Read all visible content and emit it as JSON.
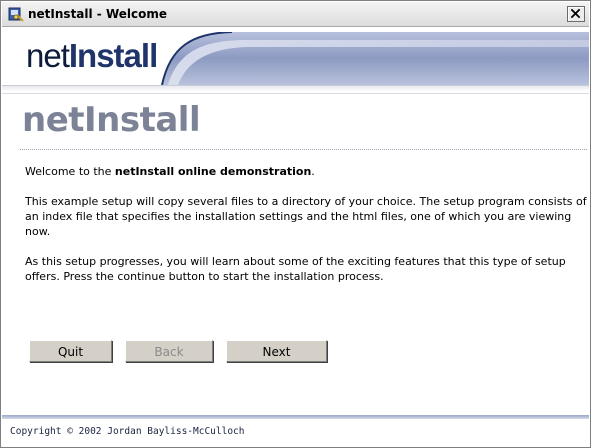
{
  "window": {
    "title": "netInstall - Welcome",
    "close_label": "×"
  },
  "banner": {
    "logo_prefix": "net",
    "logo_suffix": "Install"
  },
  "page": {
    "heading": "netInstall"
  },
  "content": {
    "welcome_prefix": "Welcome to the ",
    "welcome_bold": "netInstall online demonstration",
    "welcome_suffix": ".",
    "paragraph_2": "This example setup will copy several files to a directory of your choice. The setup program consists of an index file that specifies the installation settings and the html files, one of which you are viewing now.",
    "paragraph_3": "As this setup progresses, you will learn about some of the exciting features that this type of setup offers. Press the continue button to start the installation process."
  },
  "buttons": {
    "quit": "Quit",
    "back": "Back",
    "next": "Next"
  },
  "footer": {
    "copyright": "Copyright © 2002 Jordan Bayliss-McCulloch"
  },
  "colors": {
    "banner_swoosh": "#8e9bc4",
    "heading": "#7d8396",
    "logo_dark": "#1f3468",
    "button_face": "#d4d0c8"
  },
  "icons": {
    "app": "installer-app-icon",
    "close": "close-icon"
  }
}
